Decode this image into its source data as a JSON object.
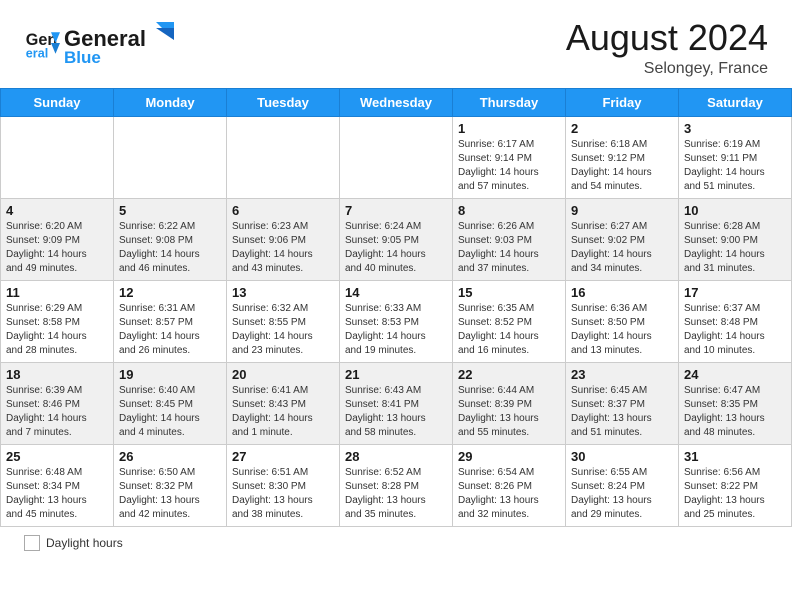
{
  "header": {
    "logo_line1": "General",
    "logo_line2": "Blue",
    "month_year": "August 2024",
    "location": "Selongey, France"
  },
  "weekdays": [
    "Sunday",
    "Monday",
    "Tuesday",
    "Wednesday",
    "Thursday",
    "Friday",
    "Saturday"
  ],
  "legend": {
    "label": "Daylight hours"
  },
  "weeks": [
    [
      {
        "day": "",
        "info": ""
      },
      {
        "day": "",
        "info": ""
      },
      {
        "day": "",
        "info": ""
      },
      {
        "day": "",
        "info": ""
      },
      {
        "day": "1",
        "info": "Sunrise: 6:17 AM\nSunset: 9:14 PM\nDaylight: 14 hours\nand 57 minutes."
      },
      {
        "day": "2",
        "info": "Sunrise: 6:18 AM\nSunset: 9:12 PM\nDaylight: 14 hours\nand 54 minutes."
      },
      {
        "day": "3",
        "info": "Sunrise: 6:19 AM\nSunset: 9:11 PM\nDaylight: 14 hours\nand 51 minutes."
      }
    ],
    [
      {
        "day": "4",
        "info": "Sunrise: 6:20 AM\nSunset: 9:09 PM\nDaylight: 14 hours\nand 49 minutes."
      },
      {
        "day": "5",
        "info": "Sunrise: 6:22 AM\nSunset: 9:08 PM\nDaylight: 14 hours\nand 46 minutes."
      },
      {
        "day": "6",
        "info": "Sunrise: 6:23 AM\nSunset: 9:06 PM\nDaylight: 14 hours\nand 43 minutes."
      },
      {
        "day": "7",
        "info": "Sunrise: 6:24 AM\nSunset: 9:05 PM\nDaylight: 14 hours\nand 40 minutes."
      },
      {
        "day": "8",
        "info": "Sunrise: 6:26 AM\nSunset: 9:03 PM\nDaylight: 14 hours\nand 37 minutes."
      },
      {
        "day": "9",
        "info": "Sunrise: 6:27 AM\nSunset: 9:02 PM\nDaylight: 14 hours\nand 34 minutes."
      },
      {
        "day": "10",
        "info": "Sunrise: 6:28 AM\nSunset: 9:00 PM\nDaylight: 14 hours\nand 31 minutes."
      }
    ],
    [
      {
        "day": "11",
        "info": "Sunrise: 6:29 AM\nSunset: 8:58 PM\nDaylight: 14 hours\nand 28 minutes."
      },
      {
        "day": "12",
        "info": "Sunrise: 6:31 AM\nSunset: 8:57 PM\nDaylight: 14 hours\nand 26 minutes."
      },
      {
        "day": "13",
        "info": "Sunrise: 6:32 AM\nSunset: 8:55 PM\nDaylight: 14 hours\nand 23 minutes."
      },
      {
        "day": "14",
        "info": "Sunrise: 6:33 AM\nSunset: 8:53 PM\nDaylight: 14 hours\nand 19 minutes."
      },
      {
        "day": "15",
        "info": "Sunrise: 6:35 AM\nSunset: 8:52 PM\nDaylight: 14 hours\nand 16 minutes."
      },
      {
        "day": "16",
        "info": "Sunrise: 6:36 AM\nSunset: 8:50 PM\nDaylight: 14 hours\nand 13 minutes."
      },
      {
        "day": "17",
        "info": "Sunrise: 6:37 AM\nSunset: 8:48 PM\nDaylight: 14 hours\nand 10 minutes."
      }
    ],
    [
      {
        "day": "18",
        "info": "Sunrise: 6:39 AM\nSunset: 8:46 PM\nDaylight: 14 hours\nand 7 minutes."
      },
      {
        "day": "19",
        "info": "Sunrise: 6:40 AM\nSunset: 8:45 PM\nDaylight: 14 hours\nand 4 minutes."
      },
      {
        "day": "20",
        "info": "Sunrise: 6:41 AM\nSunset: 8:43 PM\nDaylight: 14 hours\nand 1 minute."
      },
      {
        "day": "21",
        "info": "Sunrise: 6:43 AM\nSunset: 8:41 PM\nDaylight: 13 hours\nand 58 minutes."
      },
      {
        "day": "22",
        "info": "Sunrise: 6:44 AM\nSunset: 8:39 PM\nDaylight: 13 hours\nand 55 minutes."
      },
      {
        "day": "23",
        "info": "Sunrise: 6:45 AM\nSunset: 8:37 PM\nDaylight: 13 hours\nand 51 minutes."
      },
      {
        "day": "24",
        "info": "Sunrise: 6:47 AM\nSunset: 8:35 PM\nDaylight: 13 hours\nand 48 minutes."
      }
    ],
    [
      {
        "day": "25",
        "info": "Sunrise: 6:48 AM\nSunset: 8:34 PM\nDaylight: 13 hours\nand 45 minutes."
      },
      {
        "day": "26",
        "info": "Sunrise: 6:50 AM\nSunset: 8:32 PM\nDaylight: 13 hours\nand 42 minutes."
      },
      {
        "day": "27",
        "info": "Sunrise: 6:51 AM\nSunset: 8:30 PM\nDaylight: 13 hours\nand 38 minutes."
      },
      {
        "day": "28",
        "info": "Sunrise: 6:52 AM\nSunset: 8:28 PM\nDaylight: 13 hours\nand 35 minutes."
      },
      {
        "day": "29",
        "info": "Sunrise: 6:54 AM\nSunset: 8:26 PM\nDaylight: 13 hours\nand 32 minutes."
      },
      {
        "day": "30",
        "info": "Sunrise: 6:55 AM\nSunset: 8:24 PM\nDaylight: 13 hours\nand 29 minutes."
      },
      {
        "day": "31",
        "info": "Sunrise: 6:56 AM\nSunset: 8:22 PM\nDaylight: 13 hours\nand 25 minutes."
      }
    ]
  ]
}
